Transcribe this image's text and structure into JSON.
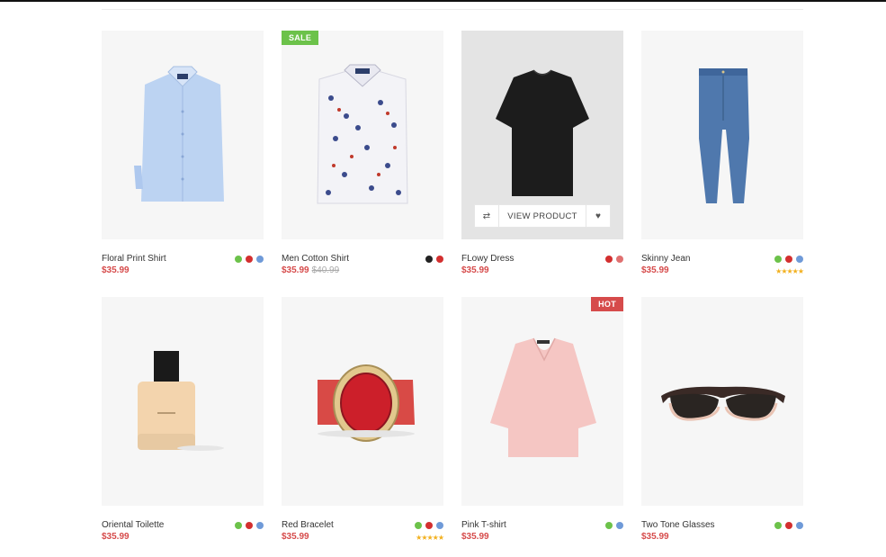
{
  "colors": {
    "green": "#6cc24a",
    "red": "#d32f2f",
    "blue": "#6f9ad8",
    "black": "#222222",
    "salmon": "#e07070",
    "price": "#d64b4b",
    "star": "#f2b01e"
  },
  "hover_actions": {
    "compare_icon": "compare-icon",
    "view_label": "VIEW PRODUCT",
    "wishlist_icon": "heart-icon"
  },
  "products": [
    {
      "name": "Floral Print Shirt",
      "price": "$35.99",
      "swatches": [
        "#6cc24a",
        "#d32f2f",
        "#6f9ad8"
      ],
      "image": "light-blue-dress-shirt"
    },
    {
      "name": "Men Cotton Shirt",
      "price": "$35.99",
      "old_price": "$40.99",
      "badge": "SALE",
      "swatches": [
        "#222222",
        "#d32f2f"
      ],
      "image": "floral-print-shirt"
    },
    {
      "name": "FLowy Dress",
      "price": "$35.99",
      "swatches": [
        "#d32f2f",
        "#e07070"
      ],
      "image": "black-dress"
    },
    {
      "name": "Skinny Jean",
      "price": "$35.99",
      "swatches": [
        "#6cc24a",
        "#d32f2f",
        "#6f9ad8"
      ],
      "rating": 5,
      "stars": "★★★★★",
      "image": "blue-jeans"
    },
    {
      "name": "Oriental Toilette",
      "price": "$35.99",
      "swatches": [
        "#6cc24a",
        "#d32f2f",
        "#6f9ad8"
      ],
      "image": "perfume-bottle"
    },
    {
      "name": "Red Bracelet",
      "price": "$35.99",
      "swatches": [
        "#6cc24a",
        "#d32f2f",
        "#6f9ad8"
      ],
      "rating": 5,
      "stars": "★★★★★",
      "image": "red-bracelet"
    },
    {
      "name": "Pink T-shirt",
      "price": "$35.99",
      "badge": "HOT",
      "swatches": [
        "#6cc24a",
        "#6f9ad8"
      ],
      "image": "pink-blouse"
    },
    {
      "name": "Two Tone Glasses",
      "price": "$35.99",
      "swatches": [
        "#6cc24a",
        "#d32f2f",
        "#6f9ad8"
      ],
      "image": "sunglasses"
    }
  ]
}
